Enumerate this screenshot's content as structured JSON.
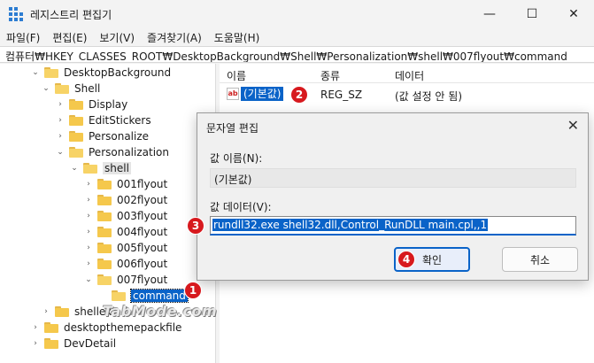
{
  "window": {
    "title": "레지스트리 편집기",
    "minimize_glyph": "—",
    "maximize_glyph": "☐",
    "close_glyph": "✕"
  },
  "menu": [
    "파일(F)",
    "편집(E)",
    "보기(V)",
    "즐겨찾기(A)",
    "도움말(H)"
  ],
  "address": "컴퓨터₩HKEY_CLASSES_ROOT₩DesktopBackground₩Shell₩Personalization₩shell₩007flyout₩command",
  "tree": {
    "items": [
      {
        "label": "DesktopBackground",
        "chevron": "v"
      },
      {
        "label": "Shell",
        "chevron": "v"
      },
      {
        "label": "Display",
        "chevron": ">"
      },
      {
        "label": "EditStickers",
        "chevron": ">"
      },
      {
        "label": "Personalize",
        "chevron": ">"
      },
      {
        "label": "Personalization",
        "chevron": "v"
      },
      {
        "label": "shell",
        "chevron": "v"
      },
      {
        "label": "001flyout",
        "chevron": ">"
      },
      {
        "label": "002flyout",
        "chevron": ">"
      },
      {
        "label": "003flyout",
        "chevron": ">"
      },
      {
        "label": "004flyout",
        "chevron": ">"
      },
      {
        "label": "005flyout",
        "chevron": ">"
      },
      {
        "label": "006flyout",
        "chevron": ">"
      },
      {
        "label": "007flyout",
        "chevron": "v"
      },
      {
        "label": "command",
        "chevron": ""
      },
      {
        "label": "shellex",
        "chevron": ">"
      },
      {
        "label": "desktopthemepackfile",
        "chevron": ">"
      },
      {
        "label": "DevDetail",
        "chevron": ">"
      }
    ]
  },
  "list": {
    "headers": [
      "이름",
      "종류",
      "데이터"
    ],
    "row": {
      "icon": "ab",
      "name": "(기본값)",
      "type": "REG_SZ",
      "data": "(값 설정 안 됨)"
    }
  },
  "dialog": {
    "title": "문자열 편집",
    "close_glyph": "✕",
    "name_label": "값 이름(N):",
    "name_value": "(기본값)",
    "data_label": "값 데이터(V):",
    "data_value": "rundll32.exe shell32.dll,Control_RunDLL main.cpl,,1",
    "ok_label": "확인",
    "cancel_label": "취소"
  },
  "badges": [
    "1",
    "2",
    "3",
    "4"
  ],
  "watermark": "TabMode.com",
  "colors": {
    "accent": "#0a63c8",
    "badge": "#d7191e",
    "folder": "#f5c84c"
  }
}
